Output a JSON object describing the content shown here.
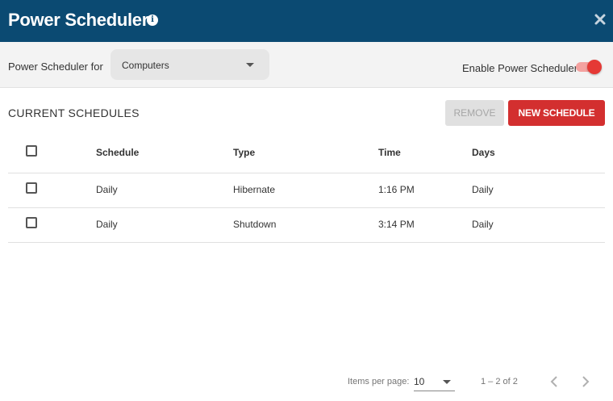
{
  "window": {
    "title": "Power Scheduler",
    "info_icon": "info-circle-icon",
    "close_icon": "close-icon"
  },
  "toolbar": {
    "for_label": "Power Scheduler for",
    "target_select": {
      "value": "Computers"
    },
    "enable_label": "Enable Power Scheduler",
    "enabled": true,
    "accent_color": "#e53935"
  },
  "schedules": {
    "section_title": "CURRENT SCHEDULES",
    "remove_label": "REMOVE",
    "new_label": "NEW SCHEDULE",
    "columns": {
      "schedule": "Schedule",
      "type": "Type",
      "time": "Time",
      "days": "Days"
    },
    "rows": [
      {
        "schedule": "Daily",
        "type": "Hibernate",
        "time": "1:16 PM",
        "days": "Daily"
      },
      {
        "schedule": "Daily",
        "type": "Shutdown",
        "time": "3:14 PM",
        "days": "Daily"
      }
    ]
  },
  "pagination": {
    "items_per_page_label": "Items per page:",
    "items_per_page": "10",
    "range_text": "1 – 2 of 2"
  },
  "colors": {
    "header_bg": "#0b4a72",
    "primary_button": "#d32f2f",
    "disabled_button": "#e0e0e0"
  }
}
